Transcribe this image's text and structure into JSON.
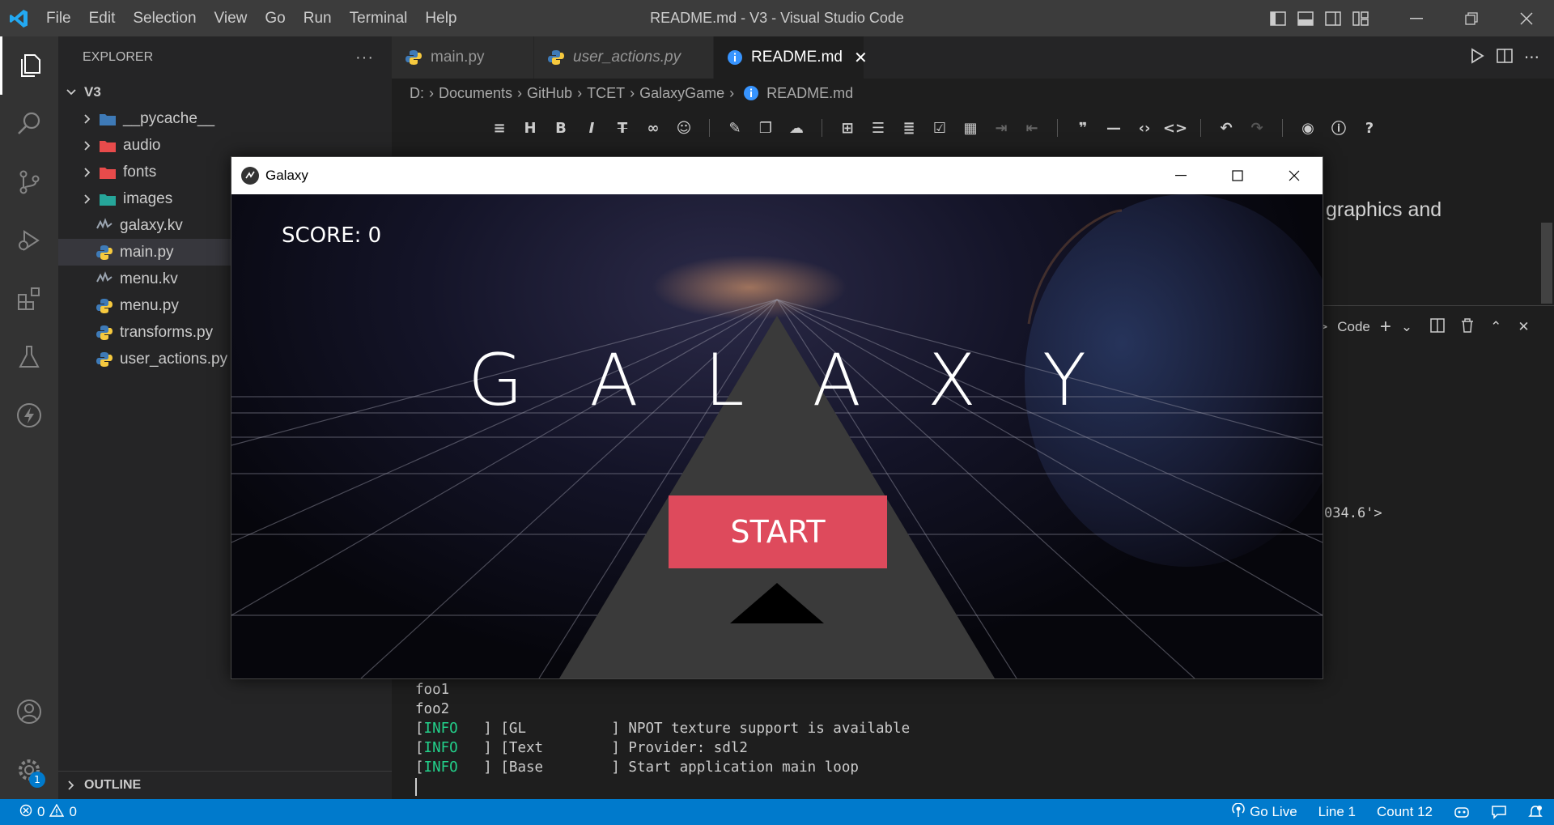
{
  "titlebar": {
    "menu": [
      "File",
      "Edit",
      "Selection",
      "View",
      "Go",
      "Run",
      "Terminal",
      "Help"
    ],
    "title": "README.md - V3 - Visual Studio Code"
  },
  "sidebar": {
    "header": "EXPLORER",
    "root": "V3",
    "items": [
      {
        "label": "__pycache__",
        "type": "folder",
        "icon": "folder-pycache-icon"
      },
      {
        "label": "audio",
        "type": "folder",
        "icon": "folder-audio-icon"
      },
      {
        "label": "fonts",
        "type": "folder",
        "icon": "folder-fonts-icon"
      },
      {
        "label": "images",
        "type": "folder",
        "icon": "folder-images-icon"
      },
      {
        "label": "galaxy.kv",
        "type": "file",
        "icon": "kivy-file-icon"
      },
      {
        "label": "main.py",
        "type": "file",
        "icon": "python-file-icon",
        "selected": true
      },
      {
        "label": "menu.kv",
        "type": "file",
        "icon": "kivy-file-icon"
      },
      {
        "label": "menu.py",
        "type": "file",
        "icon": "python-file-icon"
      },
      {
        "label": "transforms.py",
        "type": "file",
        "icon": "python-file-icon"
      },
      {
        "label": "user_actions.py",
        "type": "file",
        "icon": "python-file-icon"
      }
    ],
    "outline": "OUTLINE"
  },
  "tabs": [
    {
      "label": "main.py",
      "active": false
    },
    {
      "label": "user_actions.py",
      "active": false
    },
    {
      "label": "README.md",
      "active": true
    }
  ],
  "breadcrumb": [
    "D:",
    "Documents",
    "GitHub",
    "TCET",
    "GalaxyGame",
    "README.md"
  ],
  "preview": {
    "text": "graphics and"
  },
  "panel": {
    "label": "Code",
    "fragment": "034.6'>"
  },
  "terminal": {
    "lines": [
      {
        "plain": "foo1"
      },
      {
        "plain": "foo2"
      },
      {
        "level": "INFO",
        "pre": "[",
        "post": "   ] [GL          ] NPOT texture support is available"
      },
      {
        "level": "INFO",
        "pre": "[",
        "post": "   ] [Text        ] Provider: sdl2"
      },
      {
        "level": "INFO",
        "pre": "[",
        "post": "   ] [Base        ] Start application main loop"
      }
    ]
  },
  "galaxy": {
    "window_title": "Galaxy",
    "score": "SCORE: 0",
    "logo": "GALAXY",
    "start": "START"
  },
  "statusbar": {
    "errors": "0",
    "warnings": "0",
    "golive": "Go Live",
    "line": "Line 1",
    "count": "Count 12",
    "notification_count": "1"
  },
  "colors": {
    "accent": "#007acc",
    "start_button": "#de4a5c",
    "info_green": "#23d18b"
  }
}
